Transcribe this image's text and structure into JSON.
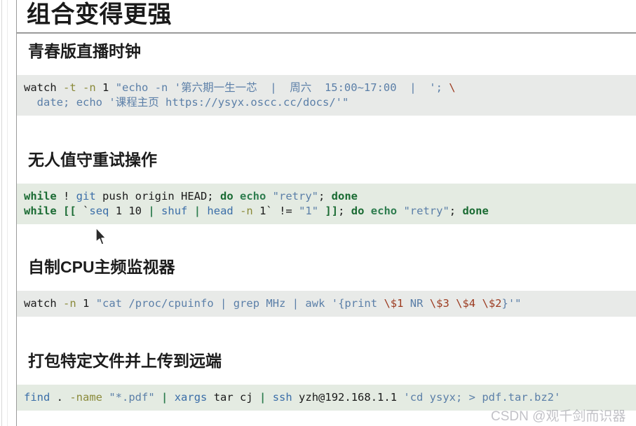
{
  "slide": {
    "title": "组合变得更强",
    "watermark": "CSDN @观千剑而识器"
  },
  "sections": [
    {
      "heading": "青春版直播时钟",
      "code_lines": [
        [
          {
            "t": "watch",
            "c": "plain"
          },
          {
            "t": " ",
            "c": "plain"
          },
          {
            "t": "-t",
            "c": "opt"
          },
          {
            "t": " ",
            "c": "plain"
          },
          {
            "t": "-n",
            "c": "opt"
          },
          {
            "t": " 1 ",
            "c": "plain"
          },
          {
            "t": "\"echo",
            "c": "str"
          },
          {
            "t": " ",
            "c": "plain"
          },
          {
            "t": "-n",
            "c": "str"
          },
          {
            "t": " ",
            "c": "plain"
          },
          {
            "t": "'第六期一生一芯",
            "c": "str"
          },
          {
            "t": "  |  ",
            "c": "str"
          },
          {
            "t": "周六",
            "c": "str"
          },
          {
            "t": "  ",
            "c": "str"
          },
          {
            "t": "15:00~17:00",
            "c": "str"
          },
          {
            "t": "  |  ",
            "c": "str"
          },
          {
            "t": "';",
            "c": "str"
          },
          {
            "t": " ",
            "c": "plain"
          },
          {
            "t": "\\",
            "c": "esc"
          }
        ],
        [
          {
            "t": "  ",
            "c": "plain"
          },
          {
            "t": "date;",
            "c": "str"
          },
          {
            "t": " ",
            "c": "plain"
          },
          {
            "t": "echo",
            "c": "str"
          },
          {
            "t": " ",
            "c": "plain"
          },
          {
            "t": "'课程主页",
            "c": "str"
          },
          {
            "t": " ",
            "c": "str"
          },
          {
            "t": "https://ysyx.oscc.cc/docs/'\"",
            "c": "str"
          }
        ]
      ]
    },
    {
      "heading": "无人值守重试操作",
      "code_lines": [
        [
          {
            "t": "while",
            "c": "kw"
          },
          {
            "t": " ! ",
            "c": "plain"
          },
          {
            "t": "git",
            "c": "fn"
          },
          {
            "t": " push origin HEAD; ",
            "c": "plain"
          },
          {
            "t": "do",
            "c": "kw"
          },
          {
            "t": " ",
            "c": "plain"
          },
          {
            "t": "echo",
            "c": "pipe"
          },
          {
            "t": " ",
            "c": "plain"
          },
          {
            "t": "\"retry\"",
            "c": "str"
          },
          {
            "t": "; ",
            "c": "plain"
          },
          {
            "t": "done",
            "c": "kw"
          }
        ],
        [
          {
            "t": "while",
            "c": "kw"
          },
          {
            "t": " ",
            "c": "plain"
          },
          {
            "t": "[[",
            "c": "kw"
          },
          {
            "t": " `",
            "c": "plain"
          },
          {
            "t": "seq",
            "c": "fn"
          },
          {
            "t": " 1 10 ",
            "c": "plain"
          },
          {
            "t": "|",
            "c": "pipe"
          },
          {
            "t": " ",
            "c": "plain"
          },
          {
            "t": "shuf",
            "c": "fn"
          },
          {
            "t": " ",
            "c": "plain"
          },
          {
            "t": "|",
            "c": "pipe"
          },
          {
            "t": " ",
            "c": "plain"
          },
          {
            "t": "head",
            "c": "fn"
          },
          {
            "t": " ",
            "c": "plain"
          },
          {
            "t": "-n",
            "c": "opt"
          },
          {
            "t": " 1` != ",
            "c": "plain"
          },
          {
            "t": "\"1\"",
            "c": "str"
          },
          {
            "t": " ",
            "c": "plain"
          },
          {
            "t": "]]",
            "c": "kw"
          },
          {
            "t": "; ",
            "c": "plain"
          },
          {
            "t": "do",
            "c": "kw"
          },
          {
            "t": " ",
            "c": "plain"
          },
          {
            "t": "echo",
            "c": "pipe"
          },
          {
            "t": " ",
            "c": "plain"
          },
          {
            "t": "\"retry\"",
            "c": "str"
          },
          {
            "t": "; ",
            "c": "plain"
          },
          {
            "t": "done",
            "c": "kw"
          }
        ]
      ]
    },
    {
      "heading": "自制CPU主频监视器",
      "code_lines": [
        [
          {
            "t": "watch",
            "c": "plain"
          },
          {
            "t": " ",
            "c": "plain"
          },
          {
            "t": "-n",
            "c": "opt"
          },
          {
            "t": " 1 ",
            "c": "plain"
          },
          {
            "t": "\"cat",
            "c": "str"
          },
          {
            "t": " ",
            "c": "plain"
          },
          {
            "t": "/proc/cpuinfo",
            "c": "str"
          },
          {
            "t": " ",
            "c": "plain"
          },
          {
            "t": "|",
            "c": "str"
          },
          {
            "t": " ",
            "c": "plain"
          },
          {
            "t": "grep",
            "c": "str"
          },
          {
            "t": " ",
            "c": "plain"
          },
          {
            "t": "MHz",
            "c": "str"
          },
          {
            "t": " ",
            "c": "plain"
          },
          {
            "t": "|",
            "c": "str"
          },
          {
            "t": " ",
            "c": "plain"
          },
          {
            "t": "awk",
            "c": "str"
          },
          {
            "t": " ",
            "c": "plain"
          },
          {
            "t": "'{print",
            "c": "str"
          },
          {
            "t": " ",
            "c": "plain"
          },
          {
            "t": "\\$1",
            "c": "esc"
          },
          {
            "t": " ",
            "c": "plain"
          },
          {
            "t": "NR",
            "c": "str"
          },
          {
            "t": " ",
            "c": "plain"
          },
          {
            "t": "\\$3",
            "c": "esc"
          },
          {
            "t": " ",
            "c": "plain"
          },
          {
            "t": "\\$4",
            "c": "esc"
          },
          {
            "t": " ",
            "c": "plain"
          },
          {
            "t": "\\$2",
            "c": "esc"
          },
          {
            "t": "}'\"",
            "c": "str"
          }
        ]
      ]
    },
    {
      "heading": "打包特定文件并上传到远端",
      "code_lines": [
        [
          {
            "t": "find",
            "c": "fn"
          },
          {
            "t": " . ",
            "c": "plain"
          },
          {
            "t": "-name",
            "c": "opt"
          },
          {
            "t": " ",
            "c": "plain"
          },
          {
            "t": "\"*.pdf\"",
            "c": "str"
          },
          {
            "t": " ",
            "c": "plain"
          },
          {
            "t": "|",
            "c": "pipe"
          },
          {
            "t": " ",
            "c": "plain"
          },
          {
            "t": "xargs",
            "c": "fn"
          },
          {
            "t": " tar cj ",
            "c": "plain"
          },
          {
            "t": "|",
            "c": "pipe"
          },
          {
            "t": " ",
            "c": "plain"
          },
          {
            "t": "ssh",
            "c": "fn"
          },
          {
            "t": " yzh@192.168.1.1 ",
            "c": "plain"
          },
          {
            "t": "'cd ysyx; > pdf.tar.bz2'",
            "c": "str"
          }
        ]
      ]
    }
  ]
}
